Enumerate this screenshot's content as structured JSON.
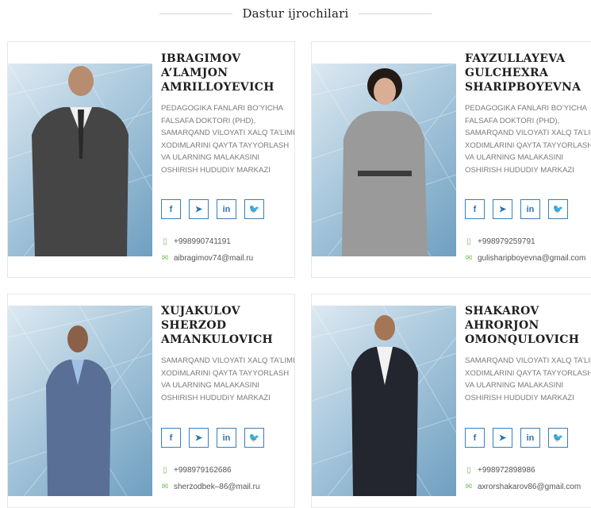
{
  "section": {
    "title": "Dastur ijrochilari"
  },
  "members": [
    {
      "name": "IBRAGIMOV A’LAMJON AMRILLOYEVICH",
      "description": "PEDAGOGIKA FANLARI BO’YICHA FALSAFA DOKTORI (PHD), SAMARQAND VILOYATI XALQ TA’LIMI XODIMLARINI QAYTA TAYYORLASH VA ULARNING MALAKASINI OSHIRISH HUDUDIY MARKAZI",
      "phone": "+998990741191",
      "email": "aibragimov74@mail.ru"
    },
    {
      "name": "FAYZULLAYEVA GULCHEXRA SHARIPBOYEVNA",
      "description": "PEDAGOGIKA FANLARI BO’YICHA FALSAFA DOKTORI (PHD), SAMARQAND VILOYATI XALQ TA’LIMI XODIMLARINI QAYTA TAYYORLASH VA ULARNING MALAKASINI OSHIRISH HUDUDIY MARKAZI",
      "phone": "+998979259791",
      "email": "gulisharipboyevna@gmail.com"
    },
    {
      "name": "XUJAKULOV SHERZOD AMANKULOVICH",
      "description": "SAMARQAND VILOYATI XALQ TA’LIMI XODIMLARINI QAYTA TAYYORLASH VA ULARNING MALAKASINI OSHIRISH HUDUDIY MARKAZI",
      "phone": "+998979162686",
      "email": "sherzodbek–86@mail.ru"
    },
    {
      "name": "SHAKAROV AHRORJON OMONQULOVICH",
      "description": "SAMARQAND VILOYATI XALQ TA’LIMI XODIMLARINI QAYTA TAYYORLASH VA ULARNING MALAKASINI OSHIRISH HUDUDIY MARKAZI",
      "phone": "+998972898986",
      "email": "axrorshakarov86@gmail.com"
    }
  ],
  "social_labels": {
    "facebook": "f",
    "telegram": "➤",
    "linkedin": "in",
    "twitter": "🐦"
  },
  "icons": {
    "phone": "phone-icon",
    "email": "envelope-icon"
  },
  "colors": {
    "accent": "#2b73ad",
    "contact_icon": "#76b85a",
    "photo_bg": "#8fb6d2"
  }
}
